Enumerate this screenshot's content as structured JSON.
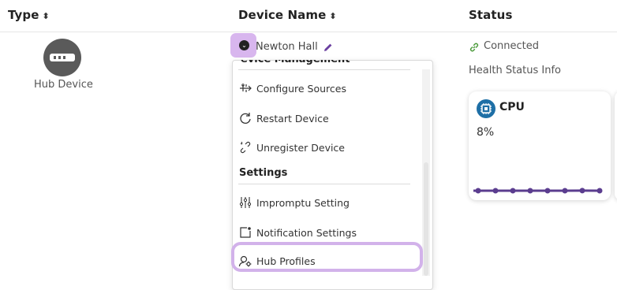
{
  "table": {
    "headers": {
      "type": "Type",
      "device_name": "Device Name",
      "status": "Status"
    },
    "sort_glyph": "⬍"
  },
  "row": {
    "type_label": "Hub Device",
    "device_name": "Newton Hall",
    "status": "Connected",
    "health_label": "Health Status Info"
  },
  "cpu_card": {
    "title": "CPU",
    "value": "8%",
    "sparkline_values": [
      8,
      8,
      8,
      8,
      8,
      8,
      8.2,
      8
    ],
    "line_color": "#5b3d8f"
  },
  "menu": {
    "section_device_management_partial": "evice Management",
    "items_device": [
      {
        "label": "Configure Sources",
        "icon": "configure-sources-icon"
      },
      {
        "label": "Restart Device",
        "icon": "restart-icon"
      },
      {
        "label": "Unregister Device",
        "icon": "unlink-icon"
      }
    ],
    "section_settings": "Settings",
    "items_settings": [
      {
        "label": "Impromptu Setting",
        "icon": "sliders-icon"
      },
      {
        "label": "Notification Settings",
        "icon": "notification-icon"
      },
      {
        "label": "Hub Profiles",
        "icon": "user-gear-icon"
      }
    ]
  },
  "colors": {
    "highlight": "#d2b2ea",
    "link_green": "#4a9a3a",
    "cpu_icon_bg": "#1e6fa6"
  }
}
